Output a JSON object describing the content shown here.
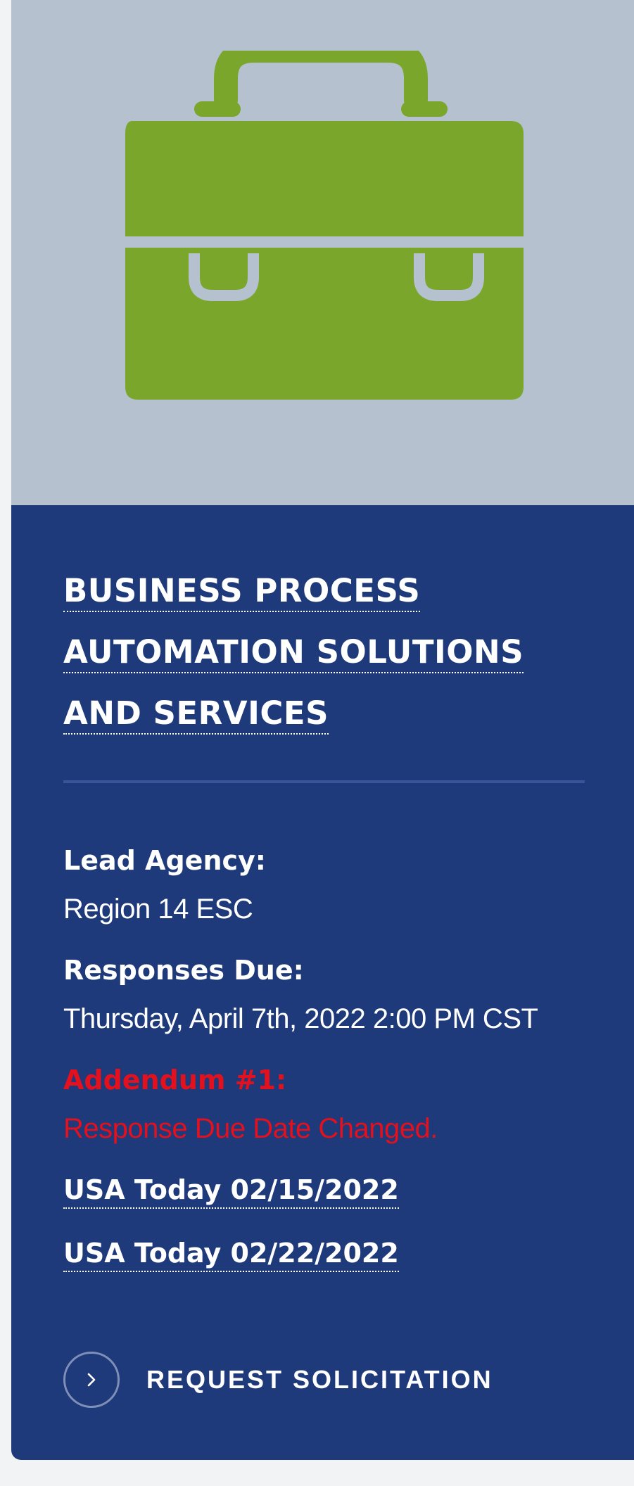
{
  "hero": {
    "icon": "briefcase-icon",
    "icon_color": "#7aa72b",
    "background": "#b6c1d0"
  },
  "solicitation": {
    "title_lines": [
      "BUSINESS PROCESS",
      "AUTOMATION SOLUTIONS",
      "AND SERVICES"
    ],
    "lead_agency_label": "Lead Agency:",
    "lead_agency_value": "Region 14 ESC",
    "responses_due_label": "Responses Due:",
    "responses_due_value": "Thursday, April 7th, 2022 2:00 PM CST",
    "addendum_label": "Addendum #1:",
    "addendum_value": "Response Due Date Changed.",
    "links": [
      "USA Today 02/15/2022",
      "USA Today 02/22/2022"
    ],
    "cta_label": "REQUEST SOLICITATION",
    "cta_icon": "chevron-right-icon"
  },
  "colors": {
    "panel": "#1e3a7a",
    "alert": "#e3101e",
    "divider": "#3a5597"
  }
}
